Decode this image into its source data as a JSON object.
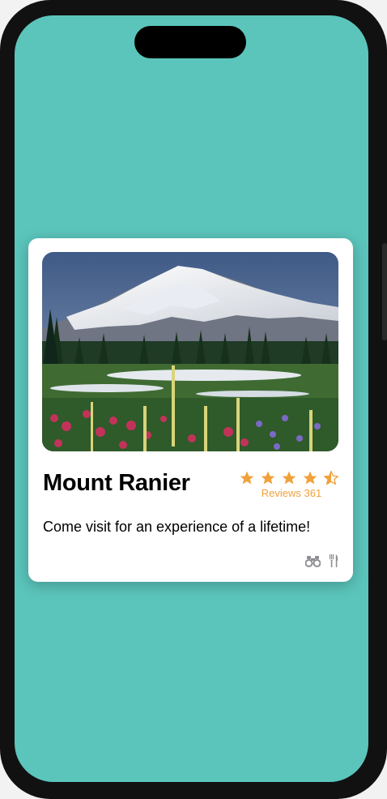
{
  "card": {
    "title": "Mount Ranier",
    "rating": 4.5,
    "rating_max": 5,
    "reviews_label": "Reviews 361",
    "tagline": "Come visit for an experience of a lifetime!",
    "photo_subject": "snow-capped mountain with wildflower meadow"
  },
  "icons": {
    "binoculars": "binoculars-icon",
    "dining": "fork-knife-icon"
  },
  "colors": {
    "background": "#5bc5bc",
    "accent": "#f0a13a",
    "icon_gray": "#8e8e93",
    "card": "#ffffff"
  }
}
